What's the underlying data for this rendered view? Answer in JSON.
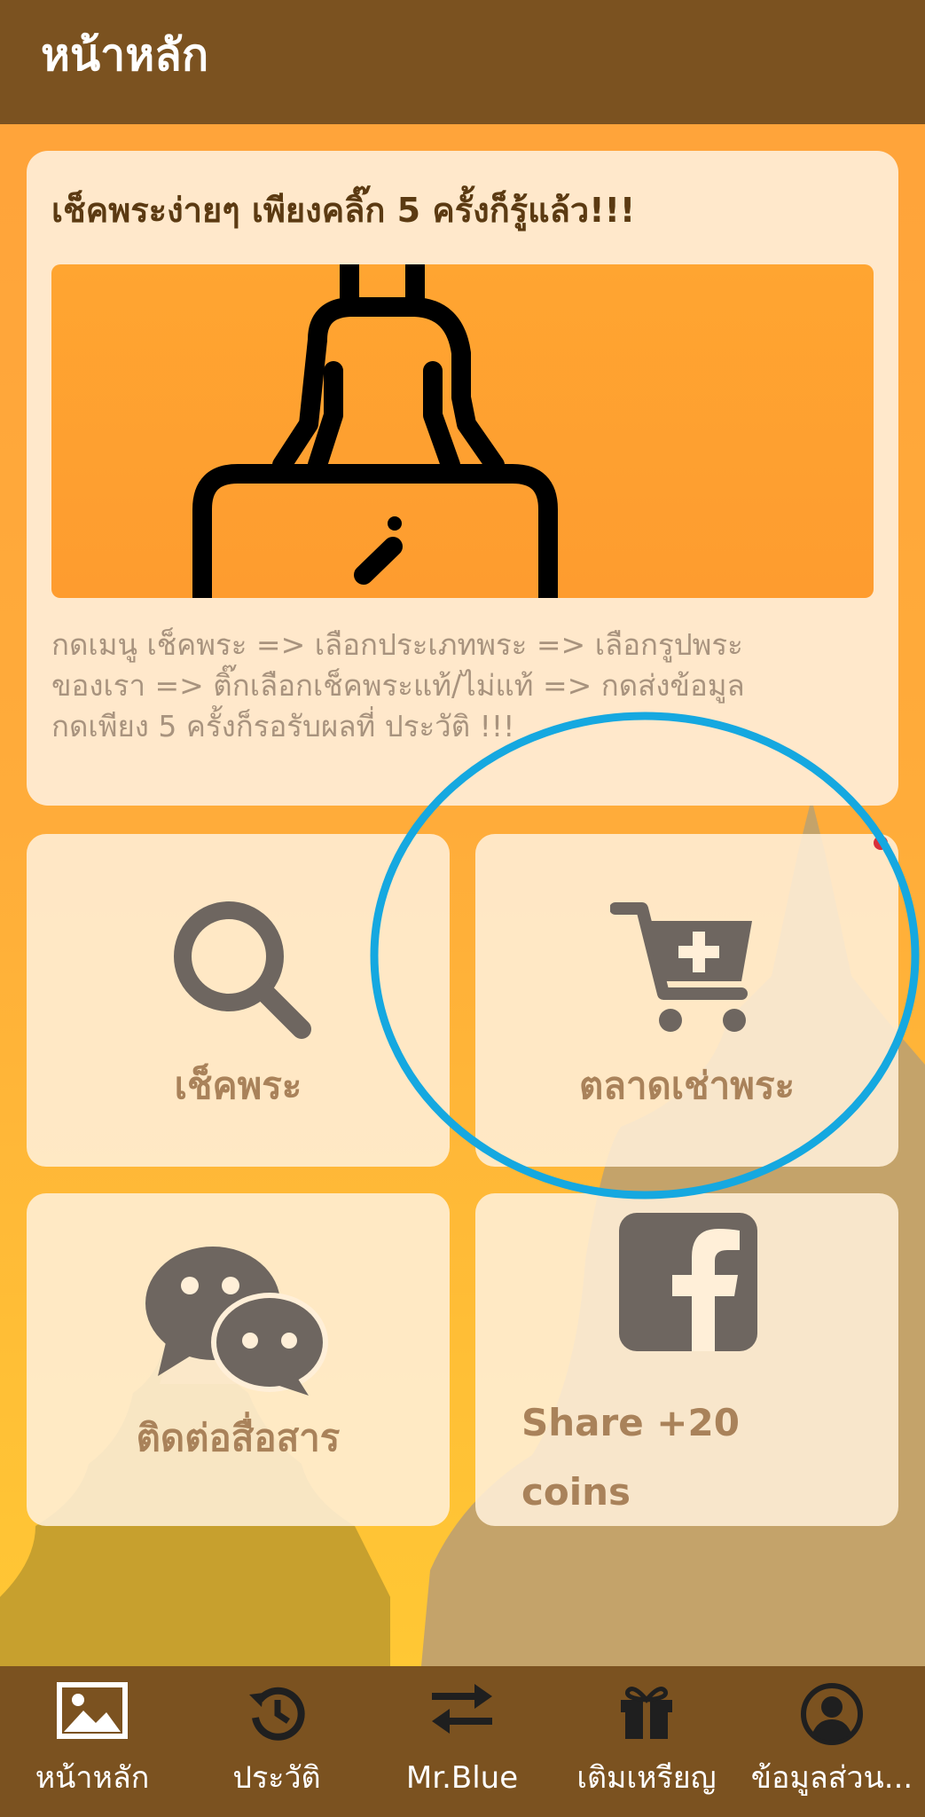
{
  "app_bar": {
    "title": "หน้าหลัก"
  },
  "info_card": {
    "title": "เช็คพระง่ายๆ เพียงคลิ๊ก 5 ครั้งก็รู้แล้ว!!!",
    "description": "กดเมนู เช็คพระ => เลือกประเภทพระ => เลือกรูปพระ\nของเรา => ติ๊กเลือกเช็คพระแท้/ไม่แท้ => กดส่งข้อมูล\nกดเพียง 5 ครั้งก็รอรับผลที่ ประวัติ !!!"
  },
  "tiles": [
    {
      "label": "เช็คพระ",
      "icon": "search-icon"
    },
    {
      "label": "ตลาดเช่าพระ",
      "icon": "cart-plus-icon"
    },
    {
      "label": "ติดต่อสื่อสาร",
      "icon": "chat-bubbles-icon"
    },
    {
      "label": "Share +20\ncoins",
      "icon": "facebook-icon"
    }
  ],
  "bottom_nav": {
    "items": [
      {
        "label": "หน้าหลัก",
        "icon": "image-icon",
        "active": true
      },
      {
        "label": "ประวัติ",
        "icon": "history-icon",
        "active": false
      },
      {
        "label": "Mr.Blue",
        "icon": "swap-arrows-icon",
        "active": false
      },
      {
        "label": "เติมเหรียญ",
        "icon": "gift-icon",
        "active": false
      },
      {
        "label": "ข้อมูลส่วน...",
        "icon": "account-circle-icon",
        "active": false
      }
    ]
  },
  "colors": {
    "app_bar": "#7b5220",
    "background": "#ffa23a",
    "card": "#ffe8cb",
    "icon_gray": "#6e6660",
    "label_brown": "#a9825a",
    "highlight_ring": "#15a8e0"
  }
}
